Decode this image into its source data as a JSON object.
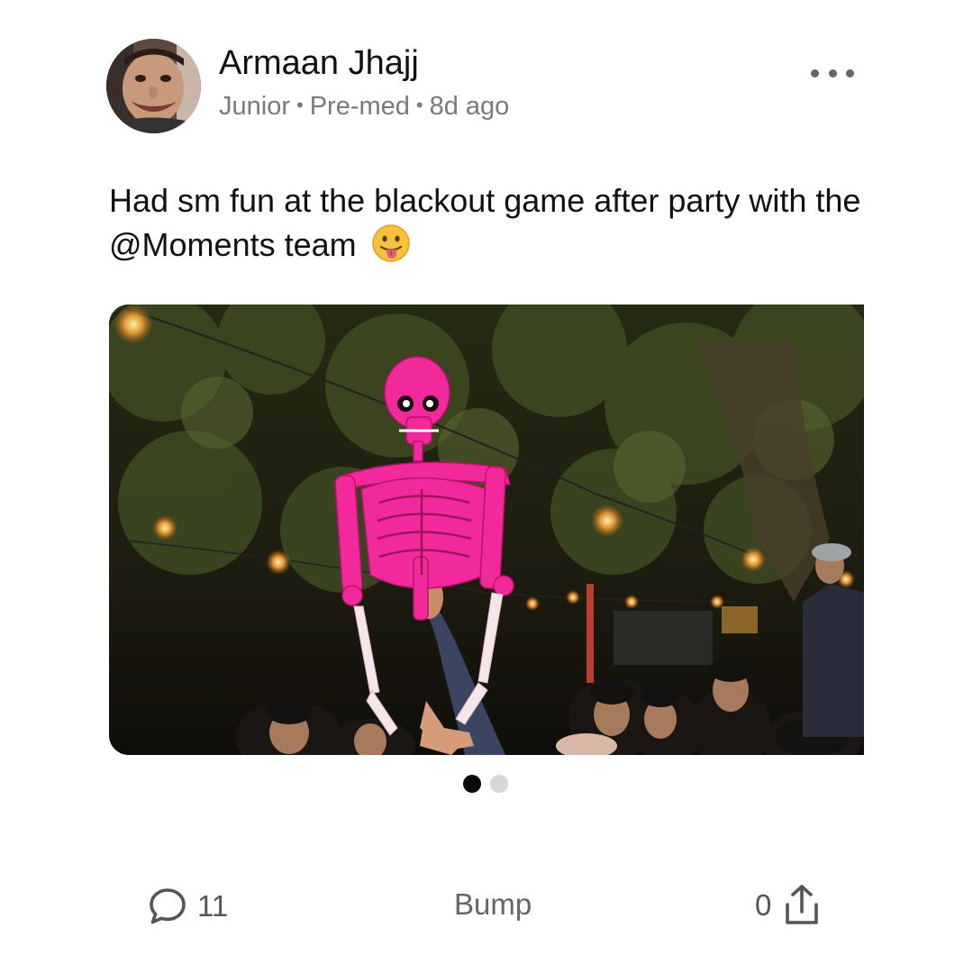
{
  "post": {
    "author": {
      "name": "Armaan Jhajj",
      "year": "Junior",
      "major": "Pre-med",
      "posted": "8d ago",
      "separator": "•"
    },
    "text": "Had sm fun at the blackout game after party with the @Moments team",
    "emoji_icon": "face-with-tongue-emoji",
    "media": {
      "current_index": 1,
      "total": 2
    },
    "actions": {
      "comment_icon": "comment-bubble-icon",
      "comment_count": "11",
      "bump_label": "Bump",
      "share_icon": "share-icon",
      "share_count": "0",
      "more_icon": "more-options-icon"
    }
  },
  "colors": {
    "text_primary": "#111111",
    "text_secondary": "#7a7a7a",
    "pager_active": "#0a0a0a",
    "pager_inactive": "#d6d6d6",
    "skeleton_pink": "#f2299a"
  }
}
